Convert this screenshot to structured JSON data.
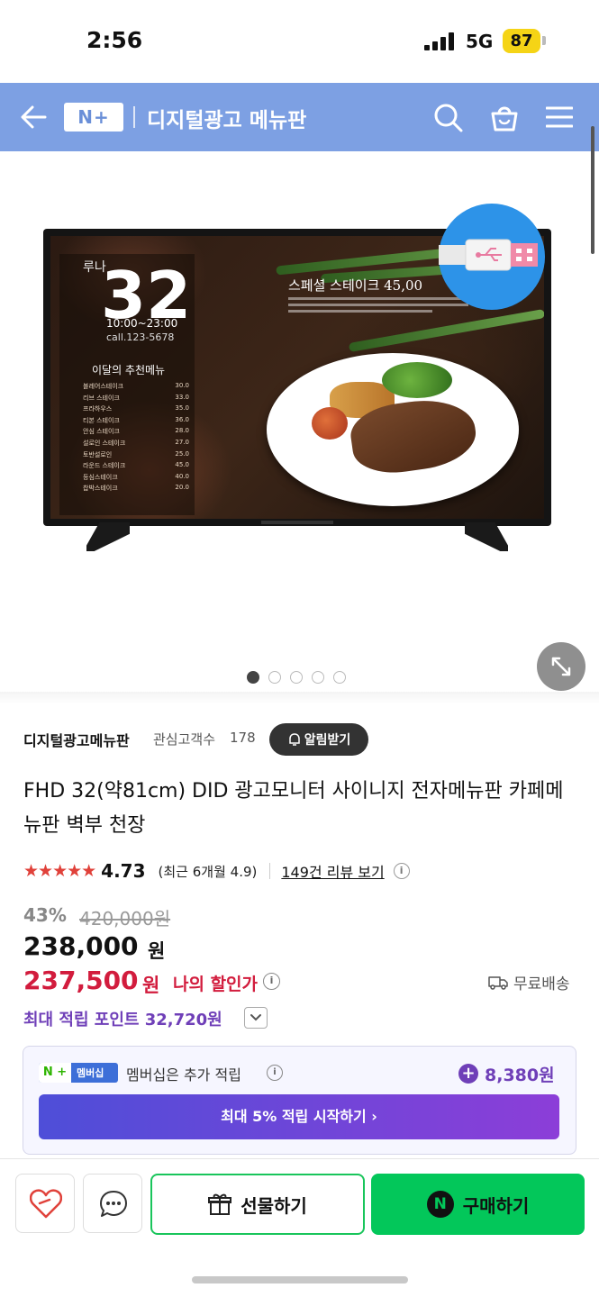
{
  "status_bar": {
    "time": "2:56",
    "network": "5G",
    "battery": "87"
  },
  "header": {
    "logo_text": "N+",
    "title": "디지털광고 메뉴판",
    "icons": [
      "back-arrow-icon",
      "search-icon",
      "cart-icon",
      "menu-icon"
    ],
    "background_color": "#7da0e3"
  },
  "product_image": {
    "screen_number": "32",
    "screen_subtitle": "루나",
    "screen_hours": "10:00~23:00",
    "screen_call": "call.123-5678",
    "screen_menu_title": "이달의 추천메뉴",
    "screen_menu_items": [
      {
        "name": "블레어스테이크",
        "price": "30.0"
      },
      {
        "name": "리브 스테이크",
        "price": "33.0"
      },
      {
        "name": "프라하우스",
        "price": "35.0"
      },
      {
        "name": "티본 스테이크",
        "price": "36.0"
      },
      {
        "name": "안심 스테이크",
        "price": "28.0"
      },
      {
        "name": "설로인 스테이크",
        "price": "27.0"
      },
      {
        "name": "토반설로인",
        "price": "25.0"
      },
      {
        "name": "라운드 스테이크",
        "price": "45.0"
      },
      {
        "name": "등심스테이크",
        "price": "40.0"
      },
      {
        "name": "찹박스테이크",
        "price": "20.0"
      }
    ],
    "screen_special": "스페셜 스테이크 45,00",
    "carousel_count": 5,
    "carousel_active_index": 0
  },
  "store": {
    "name": "디지털광고메뉴판",
    "followers_label": "관심고객수",
    "followers_count": "178",
    "notify_label": "알림받기"
  },
  "product": {
    "title": "FHD 32(약81cm) DID 광고모니터 사이니지 전자메뉴판 카페메뉴판 벽부 천장",
    "rating_stars": "★★★★★",
    "rating": "4.73",
    "recent_rating": "(최근 6개월 4.9)",
    "review_link": "149건 리뷰 보기",
    "discount_rate": "43%",
    "original_price": "420,000원",
    "sale_price": "238,000",
    "sale_won": "원",
    "my_price": "237,500",
    "my_won": "원",
    "my_discount_label": "나의 할인가",
    "shipping": "무료배송",
    "max_points": "최대 적립 포인트 32,720원"
  },
  "membership": {
    "badge_n": "N +",
    "badge_text": "멤버십",
    "text": "멤버십은 추가 적립",
    "points": "8,380원",
    "cta": "최대 5% 적립 시작하기 ›"
  },
  "bottom_bar": {
    "gift_label": "선물하기",
    "buy_label": "구매하기",
    "buy_icon": "N",
    "accent_color": "#03c75a"
  }
}
